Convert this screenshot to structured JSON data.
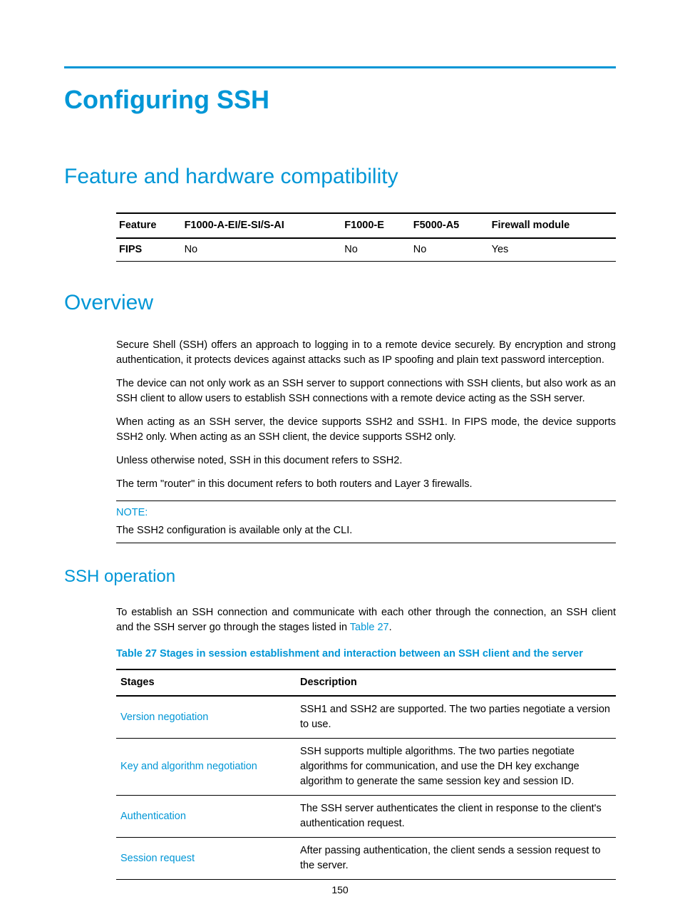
{
  "title": "Configuring SSH",
  "sections": {
    "compat": {
      "heading": "Feature and hardware compatibility",
      "table": {
        "headers": [
          "Feature",
          "F1000-A-EI/E-SI/S-AI",
          "F1000-E",
          "F5000-A5",
          "Firewall module"
        ],
        "rows": [
          {
            "cells": [
              "FIPS",
              "No",
              "No",
              "No",
              "Yes"
            ]
          }
        ]
      }
    },
    "overview": {
      "heading": "Overview",
      "paras": [
        "Secure Shell (SSH) offers an approach to logging in to a remote device securely. By encryption and strong authentication, it protects devices against attacks such as IP spoofing and plain text password interception.",
        "The device can not only work as an SSH server to support connections with SSH clients, but also work as an SSH client to allow users to establish SSH connections with a remote device acting as the SSH server.",
        "When acting as an SSH server, the device supports SSH2 and SSH1. In FIPS mode, the device supports SSH2 only. When acting as an SSH client, the device supports SSH2 only.",
        "Unless otherwise noted, SSH in this document refers to SSH2.",
        "The term \"router\" in this document refers to both routers and Layer 3 firewalls."
      ],
      "note": {
        "label": "NOTE:",
        "text": "The SSH2 configuration is available only at the CLI."
      }
    },
    "sshop": {
      "heading": "SSH operation",
      "intro_prefix": "To establish an SSH connection and communicate with each other through the connection, an SSH client and the SSH server go through the stages listed in ",
      "intro_link": "Table 27",
      "intro_suffix": ".",
      "caption": "Table 27 Stages in session establishment and interaction between an SSH client and the server",
      "table": {
        "headers": [
          "Stages",
          "Description"
        ],
        "rows": [
          {
            "stage": "Version negotiation",
            "desc": "SSH1 and SSH2 are supported. The two parties negotiate a version to use."
          },
          {
            "stage": "Key and algorithm negotiation",
            "desc": "SSH supports multiple algorithms. The two parties negotiate algorithms for communication, and use the DH key exchange algorithm to generate the same session key and session ID."
          },
          {
            "stage": "Authentication",
            "desc": "The SSH server authenticates the client in response to the client's authentication request."
          },
          {
            "stage": "Session request",
            "desc": "After passing authentication, the client sends a session request to the server."
          }
        ]
      }
    }
  },
  "page_number": "150"
}
